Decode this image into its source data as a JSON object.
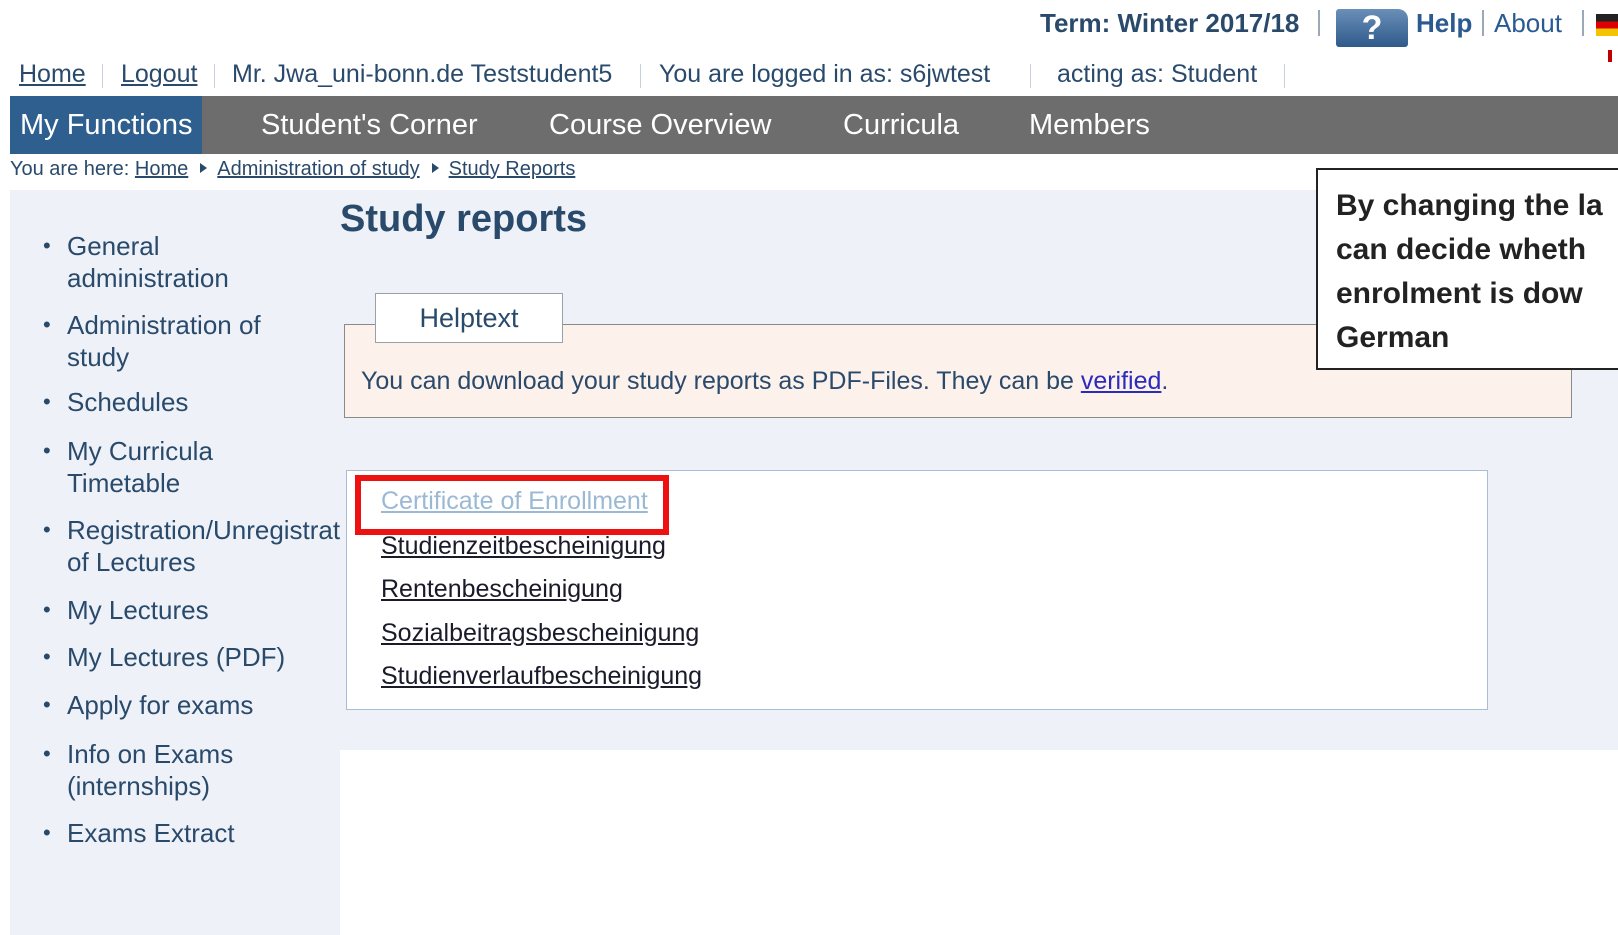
{
  "topbar": {
    "term_label": "Term: Winter 2017/18",
    "help_label": "Help",
    "about_label": "About",
    "help_icon": "?"
  },
  "userline": {
    "home": "Home",
    "logout": "Logout",
    "user_name": "Mr. Jwa_uni-bonn.de Teststudent5",
    "logged_in": "You are logged in as: s6jwtest",
    "acting_as": "acting as: Student"
  },
  "nav": {
    "items": [
      "My Functions",
      "Student's Corner",
      "Course Overview",
      "Curricula",
      "Members"
    ]
  },
  "breadcrumb": {
    "prefix": "You are here:",
    "items": [
      "Home",
      "Administration of study",
      "Study Reports"
    ]
  },
  "sidebar": {
    "items": [
      "General",
      "administration",
      "Administration of",
      "study",
      "Schedules",
      "My Curricula",
      "Timetable",
      "Registration/Unregistration",
      "of Lectures",
      "My Lectures",
      "My Lectures (PDF)",
      "Apply for exams",
      "Info on Exams",
      "(internships)",
      "Exams Extract"
    ]
  },
  "main": {
    "title": "Study reports",
    "helptext_tab": "Helptext",
    "helptext_body": "You can download your study reports as PDF-Files. They can be ",
    "helptext_link": "verified",
    "helptext_end": ".",
    "documents": [
      "Certificate of Enrollment",
      "Studienzeitbescheinigung",
      "Rentenbescheinigung",
      "Sozialbeitragsbescheinigung",
      "Studienverlaufbescheinigung"
    ]
  },
  "callout": {
    "lines": [
      "By changing the la",
      "can decide wheth",
      "enrolment is dow",
      "German"
    ]
  },
  "colors": {
    "nav_bg": "#6d6d6d",
    "nav_active": "#2e5f8f",
    "highlight_frame": "#ee1111",
    "text_blue": "#2a4a6c"
  }
}
